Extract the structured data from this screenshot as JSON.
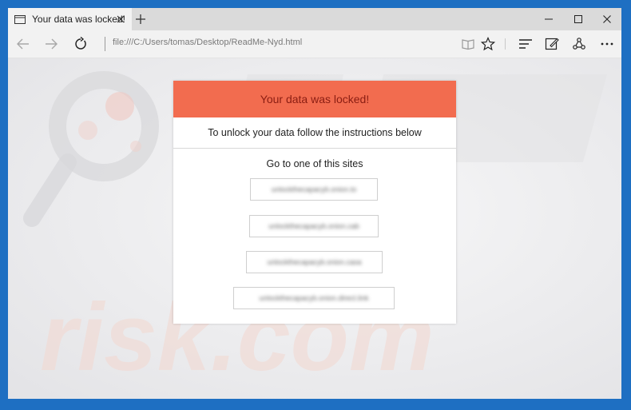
{
  "tab": {
    "title": "Your data was locked!"
  },
  "address_bar": {
    "url": "file:///C:/Users/tomas/Desktop/ReadMe-Nyd.html"
  },
  "icons": {
    "tab": "page-icon",
    "close_tab": "close-icon",
    "new_tab": "plus-icon",
    "minimize": "minimize-icon",
    "maximize": "maximize-icon",
    "close_window": "close-icon",
    "back": "arrow-left-icon",
    "forward": "arrow-right-icon",
    "refresh": "refresh-icon",
    "reading_view": "book-icon",
    "favorite": "star-icon",
    "hub": "hub-icon",
    "notes": "pen-icon",
    "share": "share-icon",
    "more": "ellipsis-icon"
  },
  "page": {
    "header": "Your data was locked!",
    "subheader": "To unlock your data follow the instructions below",
    "goto_label": "Go to one of this sites",
    "sites": [
      "unlockthecapacyb.onion.to",
      "unlockthecapacyb.onion.cab",
      "unlockthecapacyb.onion.casa",
      "unlockthecapacyb.onion.direct.link"
    ]
  },
  "colors": {
    "frame": "#1e6fc2",
    "header_bg": "#f26c4f",
    "header_text": "#8a1d12"
  }
}
